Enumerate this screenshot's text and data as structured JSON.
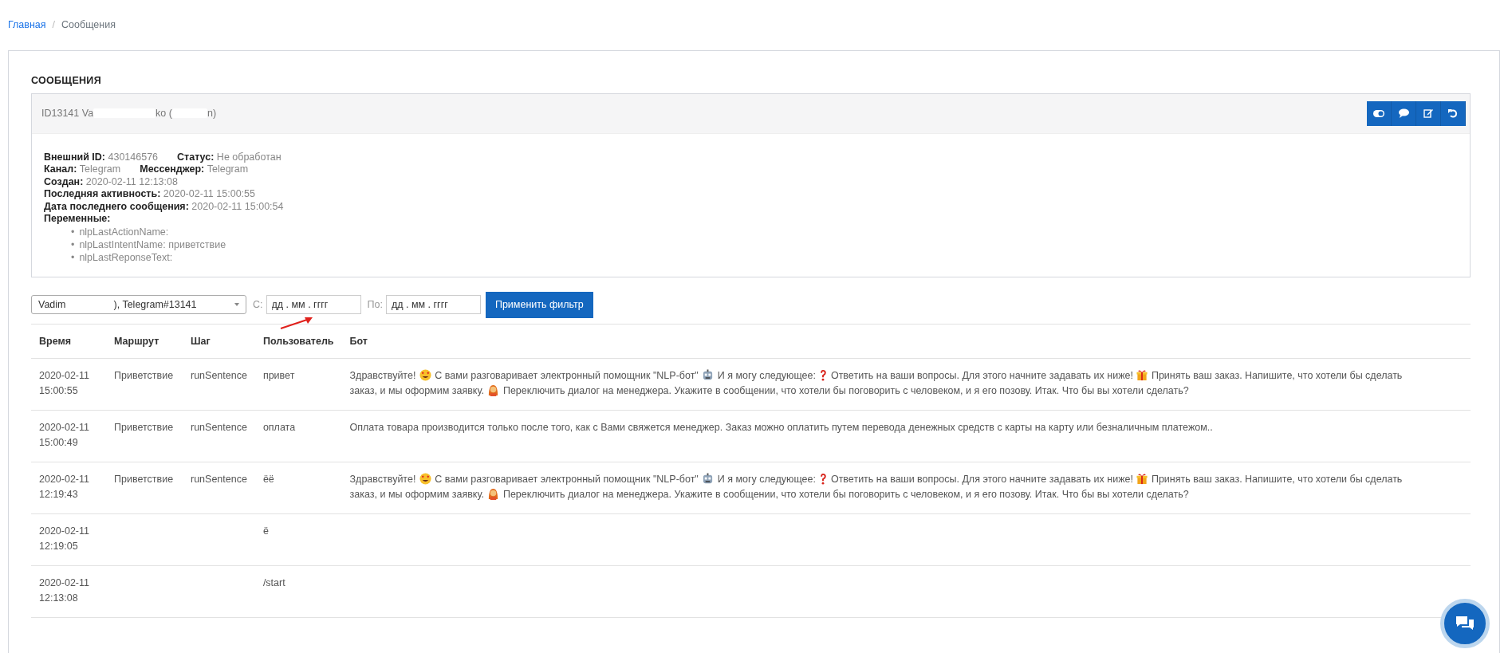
{
  "breadcrumb_separator": "/",
  "breadcrumb": [
    {
      "label": "Главная",
      "selected": false
    },
    {
      "label": "Сообщения",
      "selected": true
    }
  ],
  "page_title": "СООБЩЕНИЯ",
  "chat_header": {
    "title_parts": [
      "ID13141 Va",
      "ko (",
      "n)"
    ],
    "actions": [
      {
        "kind": "toggle"
      },
      {
        "kind": "comment"
      },
      {
        "kind": "edit"
      },
      {
        "kind": "undo"
      }
    ]
  },
  "info": [
    {
      "label": "Внешний ID:",
      "value": "430146576",
      "extra_label": "Статус:",
      "extra_value": "Не обработан"
    },
    {
      "label": "Канал:",
      "value": "Telegram",
      "extra_label": "Мессенджер:",
      "extra_value": "Telegram"
    },
    {
      "label": "Создан:",
      "value": "2020-02-11 12:13:08"
    },
    {
      "label": "Последняя активность:",
      "value": "2020-02-11 15:00:55"
    },
    {
      "label": "Дата последнего сообщения:",
      "value": "2020-02-11 15:00:54"
    }
  ],
  "variables": {
    "label": "Переменные:",
    "items": [
      {
        "marker": "•",
        "text": "nlpLastActionName:"
      },
      {
        "marker": "•",
        "text": "nlpLastIntentName: приветствие"
      },
      {
        "marker": "•",
        "text": "nlpLastReponseText:"
      }
    ]
  },
  "filter": {
    "chat_select_parts": [
      "Vadim",
      "), Telegram#13141"
    ],
    "from_label": "С:",
    "from_placeholder": "дд . мм . гггг",
    "to_label": "По:",
    "to_placeholder": "дд . мм . гггг",
    "apply_button": "Применить фильтр"
  },
  "table": {
    "columns": [
      "Время",
      "Маршрут",
      "Шаг",
      "Пользователь",
      "Бот"
    ],
    "rows": [
      {
        "time": "2020-02-11 15:00:55",
        "route": "Приветствие",
        "step": "runSentence",
        "user": "привет",
        "bot": [
          {
            "kind": "text",
            "text": "Здравствуйте!"
          },
          {
            "kind": "smiley"
          },
          {
            "kind": "text",
            "text": "С вами разговаривает электронный помощник \"NLP-бот\""
          },
          {
            "kind": "robot"
          },
          {
            "kind": "text",
            "text": "И я могу следующее:"
          },
          {
            "kind": "question"
          },
          {
            "kind": "text",
            "text": "Ответить на ваши вопросы. Для этого начните задавать их ниже!"
          },
          {
            "kind": "gift"
          },
          {
            "kind": "text",
            "text": "Принять ваш заказ. Напишите, что хотели бы сделать"
          },
          {
            "kind": "text",
            "text": "заказ, и мы оформим заявку."
          },
          {
            "kind": "person"
          },
          {
            "kind": "text",
            "text": "Переключить диалог на менеджера. Укажите в сообщении, что хотели бы поговорить с человеком, и я его позову. Итак. Что бы вы хотели сделать?"
          }
        ]
      },
      {
        "time": "2020-02-11 15:00:49",
        "route": "Приветствие",
        "step": "runSentence",
        "user": "оплата",
        "bot": [
          {
            "kind": "text",
            "text": "Оплата товара производится только после того, как с Вами свяжется менеджер. Заказ можно оплатить путем перевода денежных средств с карты на карту или безналичным платежом.."
          }
        ]
      },
      {
        "time": "2020-02-11 12:19:43",
        "route": "Приветствие",
        "step": "runSentence",
        "user": "ёё",
        "bot": [
          {
            "kind": "text",
            "text": "Здравствуйте!"
          },
          {
            "kind": "smiley"
          },
          {
            "kind": "text",
            "text": "С вами разговаривает электронный помощник \"NLP-бот\""
          },
          {
            "kind": "robot"
          },
          {
            "kind": "text",
            "text": "И я могу следующее:"
          },
          {
            "kind": "question"
          },
          {
            "kind": "text",
            "text": "Ответить на ваши вопросы. Для этого начните задавать их ниже!"
          },
          {
            "kind": "gift"
          },
          {
            "kind": "text",
            "text": "Принять ваш заказ. Напишите, что хотели бы сделать"
          },
          {
            "kind": "text",
            "text": "заказ, и мы оформим заявку."
          },
          {
            "kind": "person"
          },
          {
            "kind": "text",
            "text": "Переключить диалог на менеджера. Укажите в сообщении, что хотели бы поговорить с человеком, и я его позову. Итак. Что бы вы хотели сделать?"
          }
        ]
      },
      {
        "time": "2020-02-11 12:19:05",
        "user": "ё"
      },
      {
        "time": "2020-02-11 12:13:08",
        "user": "/start"
      }
    ]
  }
}
